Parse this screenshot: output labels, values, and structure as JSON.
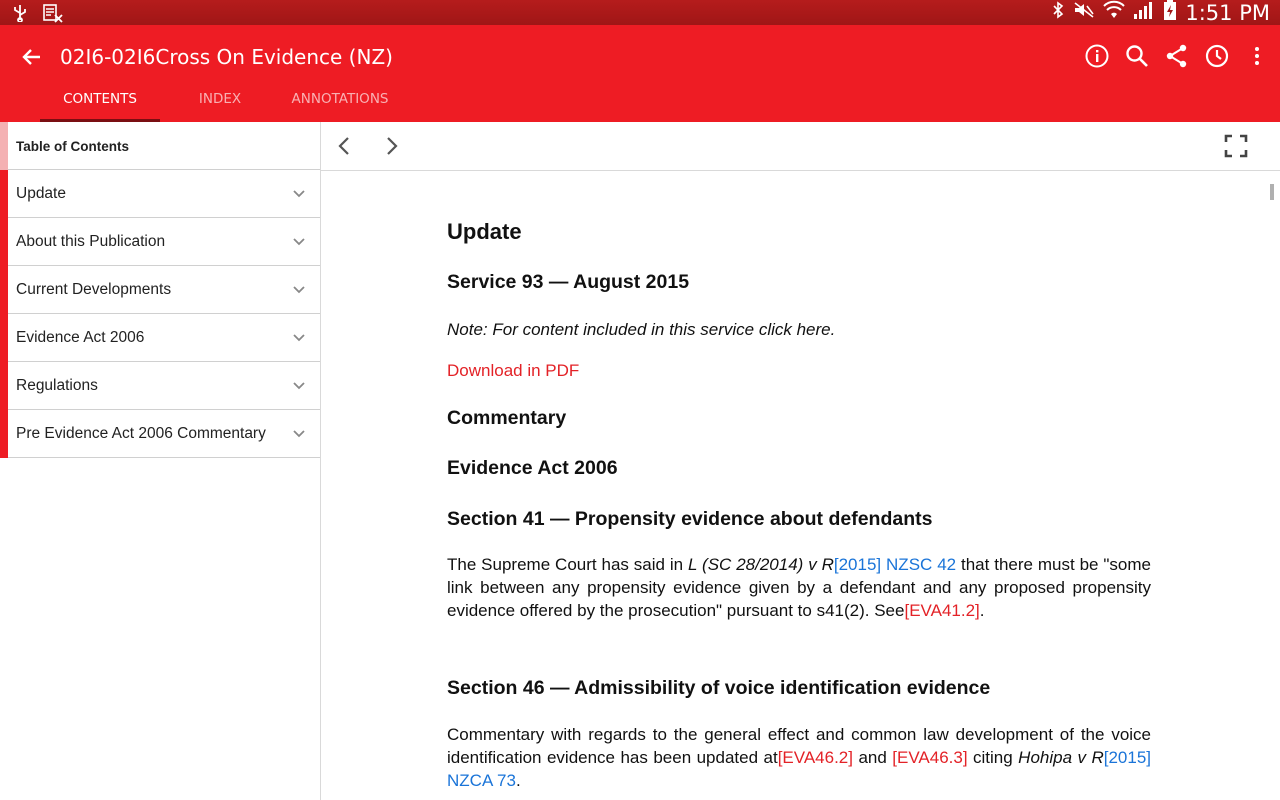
{
  "status_bar": {
    "time": "1:51 PM"
  },
  "app_bar": {
    "title": "02I6-02I6Cross On Evidence (NZ)",
    "tabs": [
      "CONTENTS",
      "INDEX",
      "ANNOTATIONS"
    ],
    "active_tab": "CONTENTS",
    "accent_color": "#ee1c24"
  },
  "sidebar": {
    "header": "Table of Contents",
    "items": [
      {
        "label": "Update"
      },
      {
        "label": "About this Publication"
      },
      {
        "label": "Current Developments"
      },
      {
        "label": "Evidence Act 2006"
      },
      {
        "label": "Regulations"
      },
      {
        "label": "Pre Evidence Act 2006 Commentary"
      }
    ]
  },
  "document": {
    "heading": "Update",
    "service": "Service 93 — August 2015",
    "note": "Note: For content included in this service click here.",
    "download_link": "Download in PDF",
    "commentary": "Commentary",
    "act": "Evidence Act 2006",
    "section41": {
      "heading": "Section 41 — Propensity evidence about defendants",
      "text_1": "The Supreme Court has said in ",
      "case_name": "L (SC 28/2014) v R",
      "citation": "[2015] NZSC 42",
      "text_2": " that there must be \"some link between any propensity evidence given by a defendant and any proposed propensity evidence offered by the prosecution\" pursuant to s41(2). See",
      "ref": "[EVA41.2]",
      "text_3": "."
    },
    "section46": {
      "heading": "Section 46 — Admissibility of voice identification evidence",
      "text_1": "Commentary with regards to the general effect and common law development of the voice identification evidence has been updated at",
      "ref_1": "[EVA46.2]",
      "text_2": " and ",
      "ref_2": "[EVA46.3]",
      "text_3": " citing ",
      "case_name": "Hohipa v R",
      "citation": "[2015] NZCA 73",
      "text_4": "."
    }
  }
}
